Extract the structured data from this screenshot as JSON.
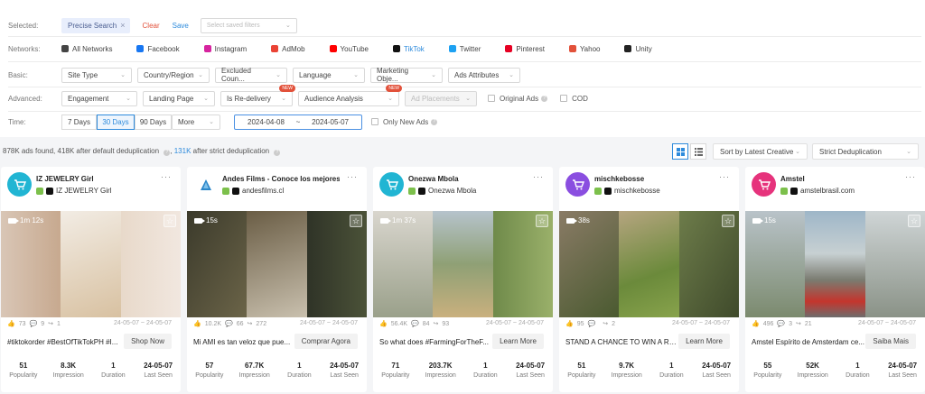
{
  "filters": {
    "selected_label": "Selected:",
    "chip_label": "Precise Search",
    "chip_close": "×",
    "clear_label": "Clear",
    "save_label": "Save",
    "saved_filters_placeholder": "Select saved filters",
    "networks_label": "Networks:",
    "networks": [
      {
        "label": "All Networks",
        "icon": "grid-icon",
        "color": "#444444",
        "active": false
      },
      {
        "label": "Facebook",
        "icon": "facebook-icon",
        "color": "#1877f2",
        "active": false
      },
      {
        "label": "Instagram",
        "icon": "instagram-icon",
        "color": "#d6249f",
        "active": false
      },
      {
        "label": "AdMob",
        "icon": "admob-icon",
        "color": "#ea4335",
        "active": false
      },
      {
        "label": "YouTube",
        "icon": "youtube-icon",
        "color": "#ff0000",
        "active": false
      },
      {
        "label": "TikTok",
        "icon": "tiktok-icon",
        "color": "#111111",
        "active": true
      },
      {
        "label": "Twitter",
        "icon": "twitter-icon",
        "color": "#1da1f2",
        "active": false
      },
      {
        "label": "Pinterest",
        "icon": "pinterest-icon",
        "color": "#e60023",
        "active": false
      },
      {
        "label": "Yahoo",
        "icon": "yahoo-icon",
        "color": "#e2513a",
        "active": false
      },
      {
        "label": "Unity",
        "icon": "unity-icon",
        "color": "#222222",
        "active": false
      }
    ],
    "basic_label": "Basic:",
    "basic": [
      "Site Type",
      "Country/Region",
      "Excluded Coun...",
      "Language",
      "Marketing Obje...",
      "Ads Attributes"
    ],
    "advanced_label": "Advanced:",
    "advanced": {
      "engagement": "Engagement",
      "landing_page": "Landing Page",
      "is_redelivery": "Is Re-delivery",
      "audience_analysis": "Audience Analysis",
      "ad_placements": "Ad Placements",
      "new_badge": "NEW",
      "original_ads": "Original Ads",
      "cod": "COD"
    },
    "time_label": "Time:",
    "time": {
      "d7": "7 Days",
      "d30": "30 Days",
      "d90": "90 Days",
      "more": "More",
      "start": "2024-04-08",
      "sep": "~",
      "end": "2024-05-07",
      "only_new_ads": "Only New Ads"
    }
  },
  "results": {
    "found": "878K ads found, 418K after default deduplication",
    "strict_count": "131K",
    "strict_suffix": "after strict deduplication",
    "sort_label": "Sort by Latest Creative",
    "dedup_label": "Strict Deduplication"
  },
  "cards": [
    {
      "name": "IZ JEWELRY Girl",
      "handle": "IZ JEWELRY Girl",
      "avatar_color": "#21b5d3",
      "avatar_icon": "cart-icon",
      "duration": "1m 12s",
      "likes": "73",
      "comments": "9",
      "shares": "1",
      "date_range": "24-05-07 ~ 24-05-07",
      "title": "#tiktokorder #BestOfTikTokPH #I...",
      "cta": "Shop Now",
      "popularity": "51",
      "impression": "8.3K",
      "duration_days": "1",
      "last_seen": "24-05-07"
    },
    {
      "name": "Andes Films - Conoce los mejores es...",
      "handle": "andesfilms.cl",
      "avatar_color": "#ffffff",
      "avatar_icon": "andes-logo-icon",
      "duration": "15s",
      "likes": "10.2K",
      "comments": "66",
      "shares": "272",
      "date_range": "24-05-07 ~ 24-05-07",
      "title": "Mi AMI es tan veloz que pue...",
      "cta": "Comprar Agora",
      "popularity": "57",
      "impression": "67.7K",
      "duration_days": "1",
      "last_seen": "24-05-07"
    },
    {
      "name": "Onezwa Mbola",
      "handle": "Onezwa Mbola",
      "avatar_color": "#21b5d3",
      "avatar_icon": "cart-icon",
      "duration": "1m 37s",
      "likes": "56.4K",
      "comments": "84",
      "shares": "93",
      "date_range": "24-05-07 ~ 24-05-07",
      "title": "So what does #FarmingForTheF...",
      "cta": "Learn More",
      "popularity": "71",
      "impression": "203.7K",
      "duration_days": "1",
      "last_seen": "24-05-07"
    },
    {
      "name": "mischkebosse",
      "handle": "mischkebosse",
      "avatar_color": "#8a4ee0",
      "avatar_icon": "cart-icon",
      "duration": "38s",
      "likes": "95",
      "comments": "",
      "shares": "2",
      "date_range": "24-05-07 ~ 24-05-07",
      "title": "STAND A CHANCE TO WIN A R10...",
      "cta": "Learn More",
      "popularity": "51",
      "impression": "9.7K",
      "duration_days": "1",
      "last_seen": "24-05-07"
    },
    {
      "name": "Amstel",
      "handle": "amstelbrasil.com",
      "avatar_color": "#e6337c",
      "avatar_icon": "cart-icon",
      "duration": "15s",
      "likes": "496",
      "comments": "3",
      "shares": "21",
      "date_range": "24-05-07 ~ 24-05-07",
      "title": "Amstel Espírito de Amsterdam ce...",
      "cta": "Saiba Mais",
      "popularity": "55",
      "impression": "52K",
      "duration_days": "1",
      "last_seen": "24-05-07"
    }
  ],
  "metric_labels": {
    "popularity": "Popularity",
    "impression": "Impression",
    "duration": "Duration",
    "last_seen": "Last Seen"
  }
}
